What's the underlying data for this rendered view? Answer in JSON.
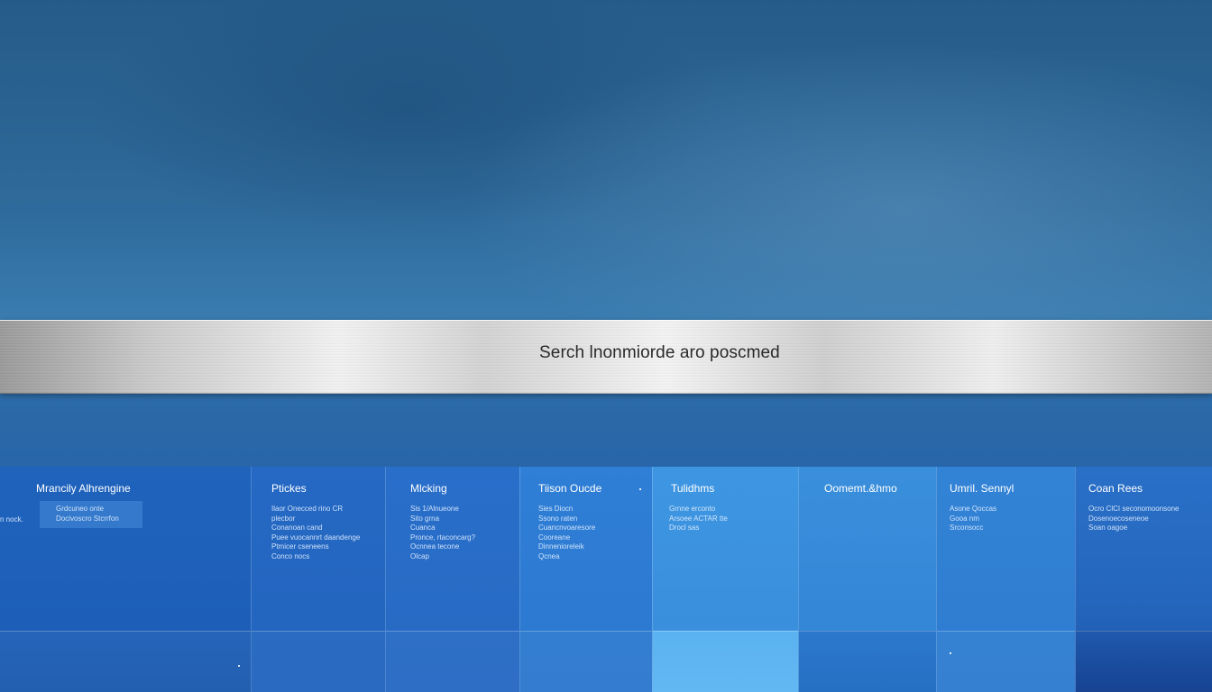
{
  "search": {
    "text": "Serch lnonmiorde aro poscmed"
  },
  "panels": [
    {
      "title": "Mrancily Alhrengine",
      "side_label": "n nock.",
      "lines": [
        "Grdcuneo onte",
        "Docivoscro Stcrrfon"
      ]
    },
    {
      "title": "Ptickes",
      "lines": [
        "Ilaor Onecced rino CR",
        "plecbor",
        "Conanoan cand",
        "Puee vuocannrt daandenge",
        "Ptmicer cseneens",
        "Conco nocs"
      ]
    },
    {
      "title": "Mlcking",
      "lines": [
        "Sis 1/Alnueone",
        "Sito grna",
        "Cuanca",
        "Pronce, rtaconcarg?",
        "Ocnnea tecone",
        "Olcap"
      ]
    },
    {
      "title": "Tiison Oucde",
      "lines": [
        "Sies Diocn",
        "Ssono raten",
        "Cuancnvoaresore",
        "Cooreane",
        "Dinnenioreleik",
        "Qcnea"
      ]
    },
    {
      "title": "Tulidhms",
      "lines": [
        "Grnne erconto",
        "Arsoee ACTAR tte",
        "Drocl sas"
      ]
    },
    {
      "title": "Oomemt.&hmo",
      "lines": []
    },
    {
      "title": "Umril. Sennyl",
      "lines": [
        "Asone Qoccas",
        "Gooa nm",
        "Srconsocc"
      ]
    },
    {
      "title": "Coan Rees",
      "lines": [
        "Ocro ClCI seconomoonsone",
        "Dosenoecoseneoe",
        "Soan oagoe"
      ]
    }
  ],
  "colors": {
    "background_top": "#255b88",
    "background_bottom": "#1f5eae",
    "panel_blue": "#2268c0",
    "panel_light": "#4aa0e6",
    "bar_silver": "#d8d8d8",
    "search_text": "#2a2a2a"
  }
}
